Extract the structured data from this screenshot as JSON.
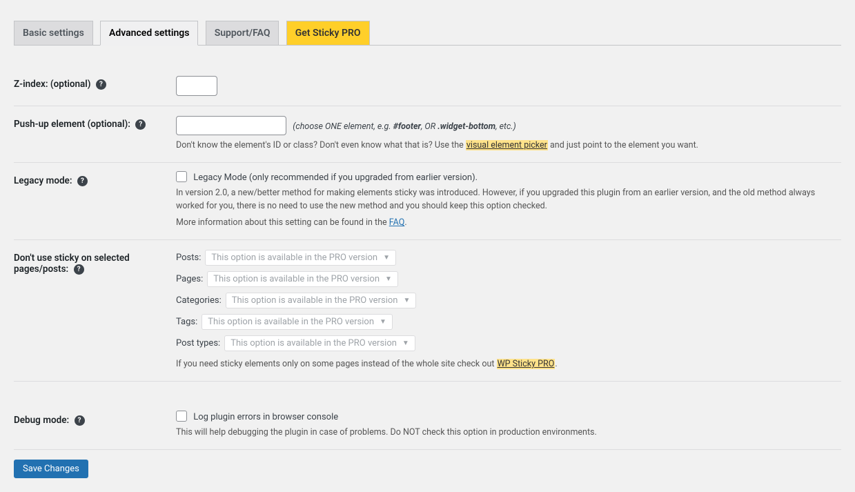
{
  "tabs": {
    "basic": "Basic settings",
    "advanced": "Advanced settings",
    "support": "Support/FAQ",
    "pro": "Get Sticky PRO"
  },
  "help_glyph": "?",
  "zindex": {
    "label": "Z-index: (optional)",
    "value": ""
  },
  "pushup": {
    "label": "Push-up element (optional):",
    "value": "",
    "hint_prefix": "(choose ONE element, e.g. ",
    "hint_ex1": "#footer",
    "hint_mid": ", OR ",
    "hint_ex2": ".widget-bottom",
    "hint_suffix": ", etc.)",
    "help_prefix": "Don't know the element's ID or class? Don't even know what that is? Use the ",
    "help_link": "visual element picker",
    "help_suffix": " and just point to the element you want."
  },
  "legacy": {
    "label": "Legacy mode:",
    "checkbox_label": "Legacy Mode (only recommended if you upgraded from earlier version).",
    "desc1": "In version 2.0, a new/better method for making elements sticky was introduced. However, if you upgraded this plugin from an earlier version, and the old method always worked for you, there is no need to use the new method and you should keep this option checked.",
    "desc2_prefix": "More information about this setting can be found in the ",
    "desc2_link": "FAQ",
    "desc2_suffix": "."
  },
  "dontuse": {
    "label": "Don't use sticky on selected pages/posts:",
    "rows": {
      "posts": "Posts:",
      "pages": "Pages:",
      "categories": "Categories:",
      "tags": "Tags:",
      "posttypes": "Post types:"
    },
    "pro_option_text": "This option is available in the PRO version",
    "footer_prefix": "If you need sticky elements only on some pages instead of the whole site check out ",
    "footer_link": "WP Sticky PRO",
    "footer_suffix": "."
  },
  "debug": {
    "label": "Debug mode:",
    "checkbox_label": "Log plugin errors in browser console",
    "desc": "This will help debugging the plugin in case of problems. Do NOT check this option in production environments."
  },
  "save_button": "Save Changes"
}
